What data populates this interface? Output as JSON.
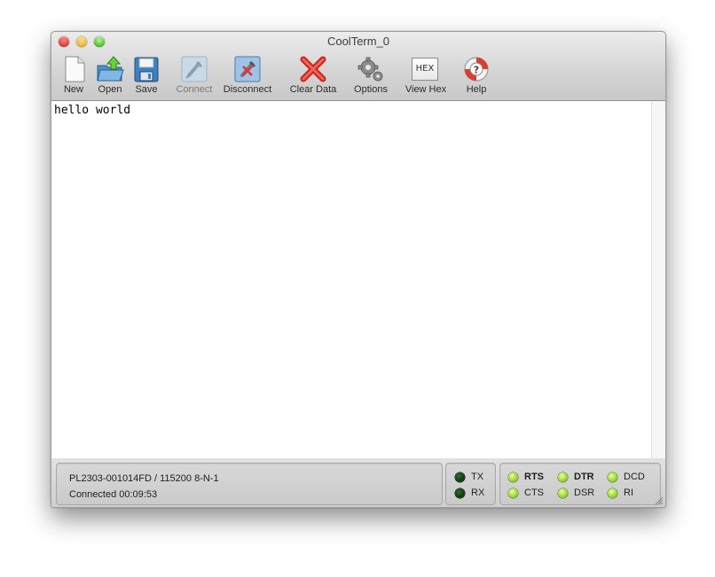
{
  "window": {
    "title": "CoolTerm_0"
  },
  "toolbar": {
    "new_label": "New",
    "open_label": "Open",
    "save_label": "Save",
    "connect_label": "Connect",
    "disconnect_label": "Disconnect",
    "clear_label": "Clear Data",
    "options_label": "Options",
    "viewhex_label": "View Hex",
    "viewhex_icon_text": "HEX",
    "help_label": "Help"
  },
  "terminal": {
    "text": "hello world"
  },
  "status": {
    "port_info": "PL2303-001014FD / 115200 8-N-1",
    "connection": "Connected 00:09:53"
  },
  "leds": {
    "tx": "TX",
    "rx": "RX",
    "rts": "RTS",
    "dtr": "DTR",
    "dcd": "DCD",
    "cts": "CTS",
    "dsr": "DSR",
    "ri": "RI"
  },
  "colors": {
    "led_dark": "#0f3d10",
    "led_bright": "#9ed83a",
    "close": "#e0443e",
    "minimize": "#f0b73c",
    "zoom": "#5fc43a"
  }
}
